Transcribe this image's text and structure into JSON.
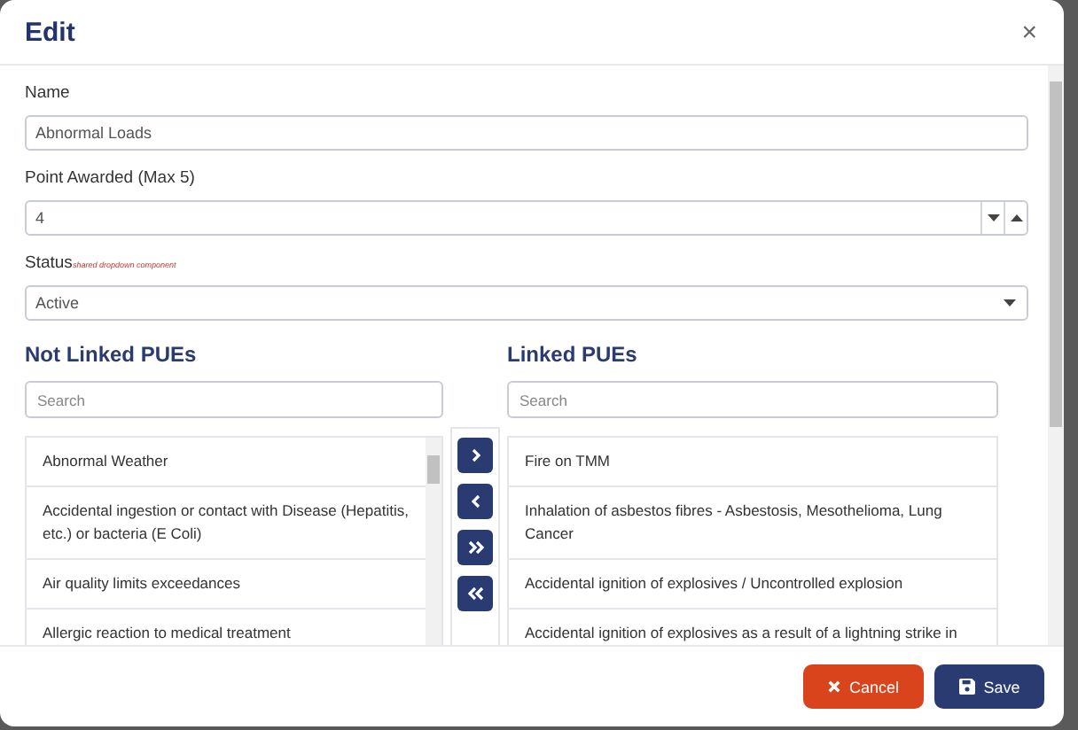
{
  "dialog": {
    "title": "Edit",
    "close": "×"
  },
  "fields": [
    {
      "kind": "text",
      "label": "Name",
      "value": "Abnormal Loads"
    },
    {
      "kind": "number",
      "label": "Point Awarded (Max 5)",
      "value": "4"
    },
    {
      "kind": "select",
      "label": "Status",
      "note": "shared dropdown component",
      "value": "Active"
    }
  ],
  "not_linked": {
    "title": "Not Linked PUEs",
    "search_placeholder": "Search",
    "items": [
      "Abnormal Weather",
      "Accidental ingestion or contact with Disease (Hepatitis, etc.) or bacteria (E Coli)",
      "Air quality limits exceedances",
      "Allergic reaction to medical treatment"
    ]
  },
  "transfer_buttons": [
    {
      "kind": "move-right"
    },
    {
      "kind": "move-left"
    },
    {
      "kind": "move-all-right"
    },
    {
      "kind": "move-all-left"
    }
  ],
  "linked": {
    "title": "Linked PUEs",
    "search_placeholder": "Search",
    "items": [
      "Fire on TMM",
      "Inhalation of asbestos fibres - Asbestosis, Mesothelioma, Lung Cancer",
      "Accidental ignition of explosives / Uncontrolled explosion",
      "Accidental ignition of explosives as a result of a lightning strike in"
    ]
  },
  "footer": {
    "cancel": "Cancel",
    "save": "Save"
  }
}
